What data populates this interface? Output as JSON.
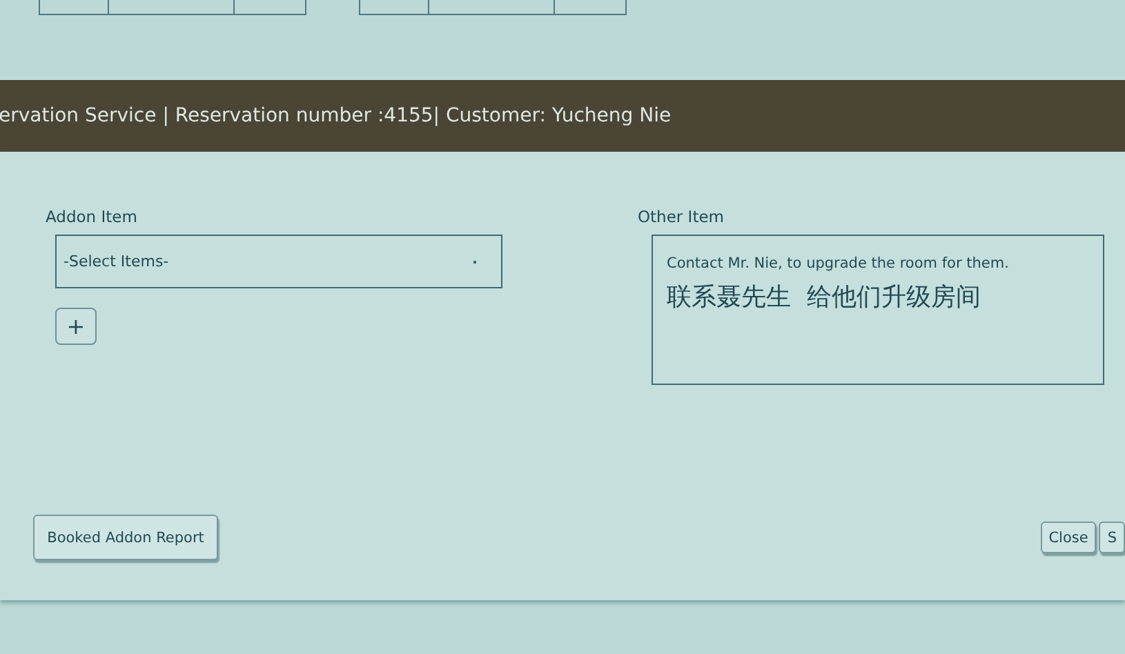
{
  "header": {
    "title": "ervation Service | Reservation number :4155| Customer:  Yucheng Nie"
  },
  "addon": {
    "label": "Addon Item",
    "select": {
      "value": "-Select Items-"
    },
    "add_button": "+"
  },
  "other": {
    "label": "Other Item",
    "lines": [
      "Contact Mr. Nie, to upgrade the room for them.",
      "联系聂先生  给他们升级房间"
    ]
  },
  "buttons": [
    {
      "label": "Booked Addon Report",
      "kind": "left"
    },
    {
      "label": "Close",
      "kind": "right"
    },
    {
      "label": "S",
      "kind": "right"
    }
  ]
}
